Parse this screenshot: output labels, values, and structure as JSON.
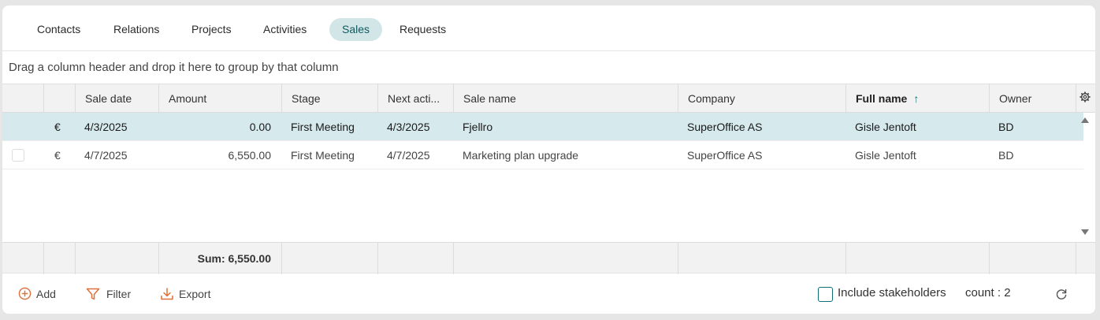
{
  "tabs": [
    {
      "label": "Contacts",
      "active": false
    },
    {
      "label": "Relations",
      "active": false
    },
    {
      "label": "Projects",
      "active": false
    },
    {
      "label": "Activities",
      "active": false
    },
    {
      "label": "Sales",
      "active": true
    },
    {
      "label": "Requests",
      "active": false
    }
  ],
  "group_hint": "Drag a column header and drop it here to group by that column",
  "columns": [
    "Sale date",
    "Amount",
    "Stage",
    "Next acti...",
    "Sale name",
    "Company",
    "Full name",
    "Owner"
  ],
  "sorted_column": "Full name",
  "sort_direction": "ascending",
  "rows": [
    {
      "currency": "€",
      "sale_date": "4/3/2025",
      "amount": "0.00",
      "stage": "First Meeting",
      "next_activity": "4/3/2025",
      "sale_name": "Fjellro",
      "company": "SuperOffice AS",
      "full_name": "Gisle Jentoft",
      "owner": "BD",
      "selected": true
    },
    {
      "currency": "€",
      "sale_date": "4/7/2025",
      "amount": "6,550.00",
      "stage": "First Meeting",
      "next_activity": "4/7/2025",
      "sale_name": "Marketing plan upgrade",
      "company": "SuperOffice AS",
      "full_name": "Gisle Jentoft",
      "owner": "BD",
      "selected": false
    }
  ],
  "footer": {
    "sum_label": "Sum: 6,550.00"
  },
  "toolbar": {
    "add_label": "Add",
    "filter_label": "Filter",
    "export_label": "Export",
    "include_stakeholders_label": "Include stakeholders",
    "include_stakeholders_checked": false,
    "count_label": "count : 2"
  },
  "colors": {
    "accent": "#0f6f72",
    "selected_row": "#d6eaee",
    "active_tab": "#d2e6e7",
    "toolbar_icon": "#e0703a"
  }
}
